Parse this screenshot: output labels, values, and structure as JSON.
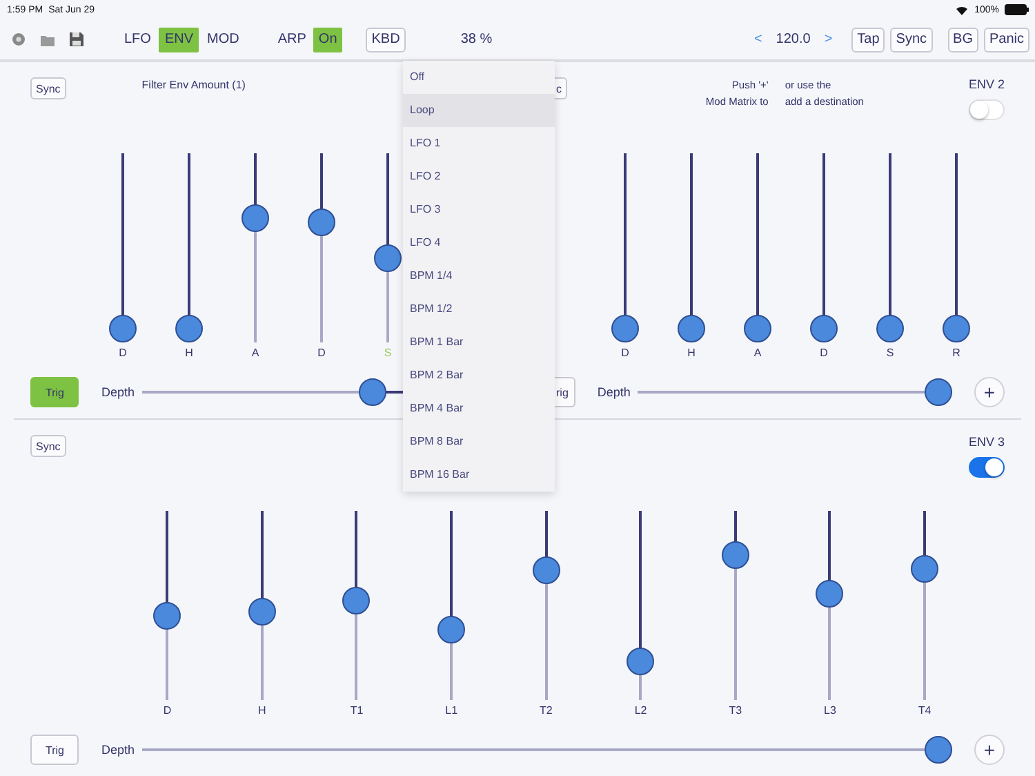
{
  "status_bar": {
    "time": "1:59 PM",
    "date": "Sat Jun 29",
    "battery": "100%"
  },
  "toolbar": {
    "tabs": [
      {
        "label": "LFO",
        "selected": false
      },
      {
        "label": "ENV",
        "selected": true
      },
      {
        "label": "MOD",
        "selected": false
      }
    ],
    "arp": {
      "label": "ARP",
      "value": "On",
      "on": true
    },
    "kbd": "KBD",
    "zoom": "38 %",
    "tempo": {
      "prev": "<",
      "value": "120.0",
      "next": ">"
    },
    "buttons": [
      "Tap",
      "Sync",
      "BG",
      "Panic"
    ]
  },
  "envelopes": [
    {
      "sync": "Sync",
      "title": "Filter Env Amount (1)",
      "sliders": [
        {
          "label": "D",
          "level": 0,
          "selected": false
        },
        {
          "label": "H",
          "level": 0,
          "selected": false
        },
        {
          "label": "A",
          "level": 0.68,
          "selected": false
        },
        {
          "label": "D",
          "level": 0.66,
          "selected": false
        },
        {
          "label": "S",
          "level": 0.44,
          "selected": true
        }
      ],
      "trig": {
        "label": "Trig",
        "on": true
      },
      "depth": {
        "label": "Depth",
        "level": 0.82
      }
    },
    {
      "sync": "c",
      "hint_lines": [
        "Push '+'",
        "or use the",
        "Mod Matrix to",
        "add a destination"
      ],
      "name": "ENV 2",
      "enabled": false,
      "sliders": [
        {
          "label": "D",
          "level": 0,
          "selected": false
        },
        {
          "label": "H",
          "level": 0,
          "selected": false
        },
        {
          "label": "A",
          "level": 0,
          "selected": false
        },
        {
          "label": "D",
          "level": 0,
          "selected": false
        },
        {
          "label": "S",
          "level": 0,
          "selected": false
        },
        {
          "label": "R",
          "level": 0,
          "selected": false
        }
      ],
      "trig": {
        "label": "rig",
        "on": false
      },
      "depth": {
        "label": "Depth",
        "level": 1
      },
      "add": "+"
    },
    {
      "sync": "Sync",
      "name": "ENV 3",
      "enabled": true,
      "sliders": [
        {
          "label": "D",
          "level": 0.44,
          "selected": false
        },
        {
          "label": "H",
          "level": 0.46,
          "selected": false
        },
        {
          "label": "T1",
          "level": 0.53,
          "selected": false
        },
        {
          "label": "L1",
          "level": 0.35,
          "selected": false
        },
        {
          "label": "T2",
          "level": 0.72,
          "selected": false
        },
        {
          "label": "L2",
          "level": 0.15,
          "selected": false
        },
        {
          "label": "T3",
          "level": 0.81,
          "selected": false
        },
        {
          "label": "L3",
          "level": 0.57,
          "selected": false
        },
        {
          "label": "T4",
          "level": 0.73,
          "selected": false
        }
      ],
      "trig": {
        "label": "Trig",
        "on": false
      },
      "depth": {
        "label": "Depth",
        "level": 1
      },
      "add": "+"
    }
  ],
  "menu": {
    "items": [
      {
        "label": "Off",
        "selected": false
      },
      {
        "label": "Loop",
        "selected": true
      },
      {
        "label": "LFO 1",
        "selected": false
      },
      {
        "label": "LFO 2",
        "selected": false
      },
      {
        "label": "LFO 3",
        "selected": false
      },
      {
        "label": "LFO 4",
        "selected": false
      },
      {
        "label": "BPM 1/4",
        "selected": false
      },
      {
        "label": "BPM 1/2",
        "selected": false
      },
      {
        "label": "BPM 1 Bar",
        "selected": false
      },
      {
        "label": "BPM 2 Bar",
        "selected": false
      },
      {
        "label": "BPM 4 Bar",
        "selected": false
      },
      {
        "label": "BPM 8 Bar",
        "selected": false
      },
      {
        "label": "BPM 16 Bar",
        "selected": false
      }
    ]
  }
}
